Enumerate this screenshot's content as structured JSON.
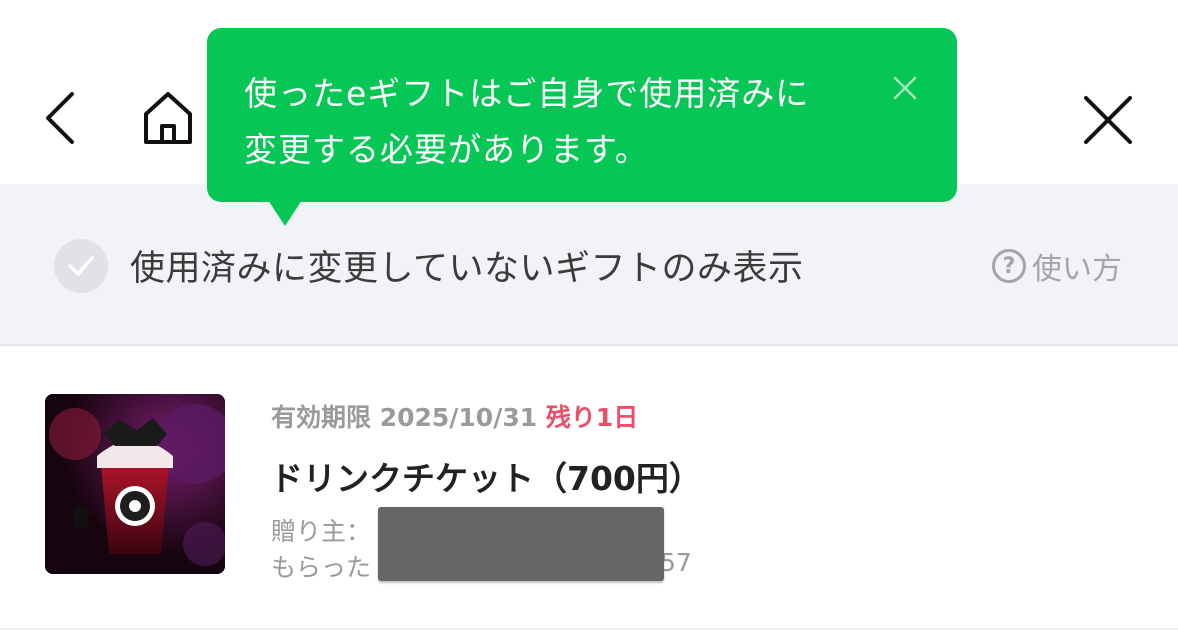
{
  "tooltip": {
    "line1": "使ったeギフトはご自身で使用済みに",
    "line2": "変更する必要があります。"
  },
  "filter": {
    "label": "使用済みに変更していないギフトのみ表示",
    "help_label": "使い方",
    "help_icon_glyph": "?"
  },
  "gift": {
    "expiry_label": "有効期限 2025/10/31",
    "remaining_label": "残り1日",
    "title": "ドリンクチケット（700円）",
    "sender_label": "贈り主：",
    "received_label": "もらった",
    "received_suffix": "57",
    "image": "starbucks-drink-image"
  },
  "colors": {
    "accent_green": "#06c755",
    "remaining_red": "#ec4f6a",
    "filter_bg": "#f2f3f7"
  },
  "icons": {
    "back": "back-arrow-icon",
    "home": "home-icon",
    "close": "close-icon"
  }
}
